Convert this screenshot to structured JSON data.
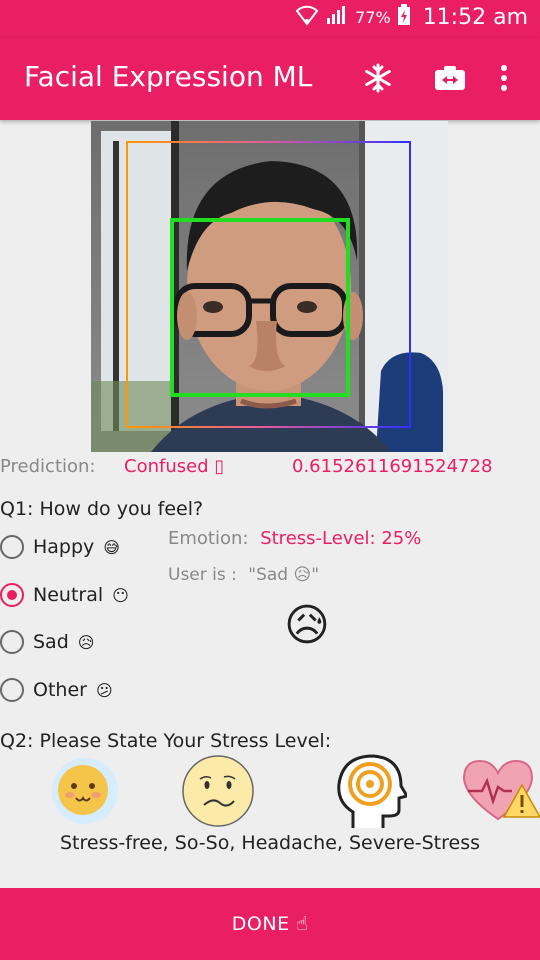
{
  "status": {
    "battery": "77%",
    "time": "11:52 am"
  },
  "app": {
    "title": "Facial Expression ML"
  },
  "prediction": {
    "label": "Prediction:",
    "value": "Confused ▯",
    "score": "0.6152611691524728"
  },
  "q1": {
    "question": "Q1: How do you feel?",
    "options": [
      {
        "label": "Happy",
        "emoji": "😅",
        "selected": false
      },
      {
        "label": "Neutral",
        "emoji": "😶",
        "selected": true
      },
      {
        "label": "Sad",
        "emoji": "😥",
        "selected": false
      },
      {
        "label": "Other",
        "emoji": "😕",
        "selected": false
      }
    ]
  },
  "emotion": {
    "label": "Emotion:",
    "stress": "Stress-Level: 25%",
    "user_label": "User is :",
    "user_value": "\"Sad 😥\"",
    "big_emoji": "😥"
  },
  "q2": {
    "question": "Q2: Please State Your Stress Level:",
    "caption": "Stress-free, So-So, Headache, Severe-Stress"
  },
  "done": {
    "label": "DONE ☝"
  },
  "colors": {
    "accent": "#e91e63",
    "detect_box": "#22dd22"
  }
}
